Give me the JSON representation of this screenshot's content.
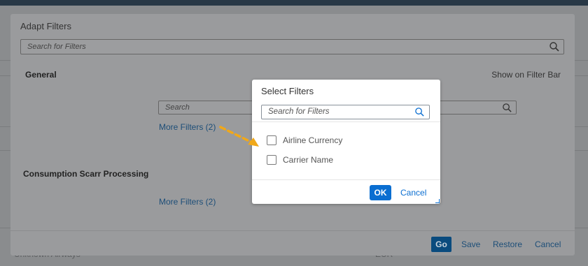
{
  "background": {
    "bottom_left_text": "Unknown Airways",
    "bottom_right_text": "EUR"
  },
  "adapt_dialog": {
    "title": "Adapt Filters",
    "search_placeholder": "Search for Filters",
    "show_on_filter_bar": "Show on Filter Bar",
    "sections": [
      {
        "title": "General",
        "search_placeholder": "Search",
        "more_filters": "More Filters (2)"
      },
      {
        "title": "Consumption Scarr Processing",
        "more_filters": "More Filters (2)"
      }
    ],
    "footer": {
      "go": "Go",
      "save": "Save",
      "restore": "Restore",
      "cancel": "Cancel"
    }
  },
  "select_filters": {
    "title": "Select Filters",
    "search_placeholder": "Search for Filters",
    "options": [
      {
        "label": "Airline Currency",
        "checked": false
      },
      {
        "label": "Carrier Name",
        "checked": false
      }
    ],
    "ok": "OK",
    "cancel": "Cancel"
  },
  "colors": {
    "accent": "#0a6ed1",
    "annotation_arrow": "#f0a81a"
  },
  "icons": [
    "search-icon",
    "checkbox-icon",
    "annotation-arrow-icon",
    "resize-grip-icon"
  ]
}
